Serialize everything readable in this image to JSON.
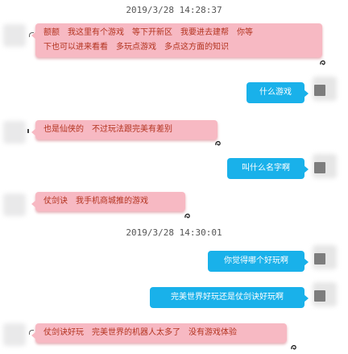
{
  "chat": {
    "timestamps": [
      "2019/3/28 14:28:37",
      "2019/3/28 14:30:01"
    ],
    "messages": [
      {
        "side": "in",
        "lines": [
          "额额　我这里有个游戏　等下开新区　我要进去建帮　你等",
          "下也可以进来看看　多玩点游戏　多点这方面的知识"
        ]
      },
      {
        "side": "out",
        "text": "什么游戏"
      },
      {
        "side": "in",
        "lines": [
          "也是仙侠的　不过玩法跟完美有差别"
        ]
      },
      {
        "side": "out",
        "text": "叫什么名字啊"
      },
      {
        "side": "in",
        "lines": [
          "仗剑诀　我手机商城推的游戏"
        ]
      },
      {
        "side": "out",
        "text": "你觉得哪个好玩啊"
      },
      {
        "side": "out",
        "text": "完美世界好玩还是仗剑诀好玩啊"
      },
      {
        "side": "in",
        "lines": [
          "仗剑诀好玩　完美世界的机器人太多了　没有游戏体验"
        ]
      }
    ]
  },
  "colors": {
    "incoming_bubble": "#f7b9c3",
    "incoming_text": "#b3331f",
    "outgoing_bubble": "#19b1ea",
    "outgoing_text": "#ffffff"
  },
  "icons": {
    "avatar": "blurred-avatar-icon",
    "status": "curled-arrow-icon"
  }
}
